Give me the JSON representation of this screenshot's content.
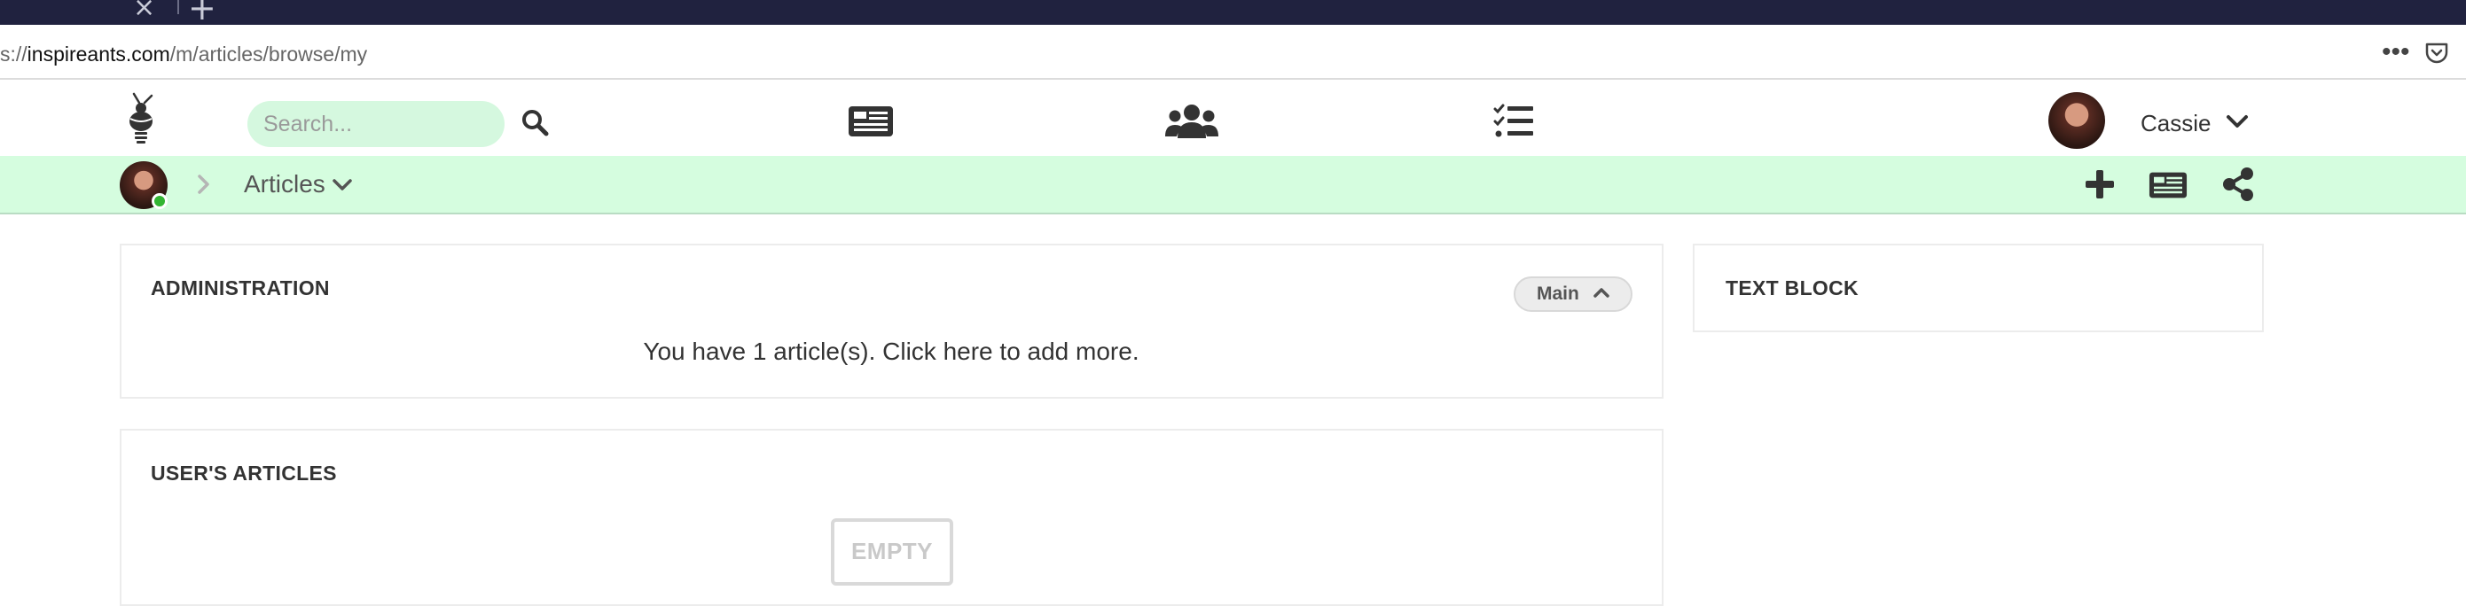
{
  "browser": {
    "url_prefix": "s://",
    "url_host": "inspireants.com",
    "url_path": "/m/articles/browse/my",
    "tab_close": "×",
    "tab_new": "+",
    "more_label": "•••"
  },
  "nav": {
    "search_placeholder": "Search...",
    "user_name": "Cassie",
    "icons": [
      "bulb-ant-logo-icon",
      "search-icon",
      "articles-icon",
      "users-icon",
      "tasks-list-icon",
      "chevron-down-icon"
    ]
  },
  "subbar": {
    "breadcrumb_label": "Articles",
    "actions": [
      "plus-icon",
      "articles-icon",
      "share-icon"
    ],
    "status_color": "#33b533",
    "bar_color": "#d5fddf"
  },
  "admin_card": {
    "title": "ADMINISTRATION",
    "tag_label": "Main",
    "message": "You have 1 article(s). Click here to add more."
  },
  "users_articles_card": {
    "title": "USER'S ARTICLES",
    "empty_label": "EMPTY"
  },
  "text_block_card": {
    "title": "TEXT BLOCK"
  }
}
